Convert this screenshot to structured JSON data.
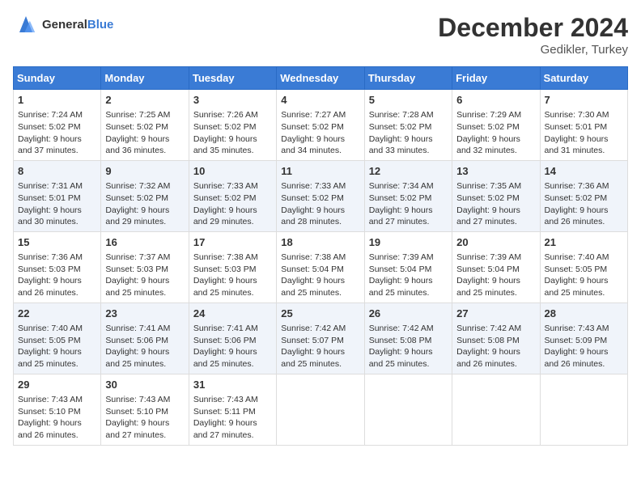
{
  "logo": {
    "text_general": "General",
    "text_blue": "Blue"
  },
  "title": "December 2024",
  "location": "Gedikler, Turkey",
  "days_header": [
    "Sunday",
    "Monday",
    "Tuesday",
    "Wednesday",
    "Thursday",
    "Friday",
    "Saturday"
  ],
  "weeks": [
    [
      {
        "day": "1",
        "sunrise": "7:24 AM",
        "sunset": "5:02 PM",
        "daylight": "9 hours and 37 minutes."
      },
      {
        "day": "2",
        "sunrise": "7:25 AM",
        "sunset": "5:02 PM",
        "daylight": "9 hours and 36 minutes."
      },
      {
        "day": "3",
        "sunrise": "7:26 AM",
        "sunset": "5:02 PM",
        "daylight": "9 hours and 35 minutes."
      },
      {
        "day": "4",
        "sunrise": "7:27 AM",
        "sunset": "5:02 PM",
        "daylight": "9 hours and 34 minutes."
      },
      {
        "day": "5",
        "sunrise": "7:28 AM",
        "sunset": "5:02 PM",
        "daylight": "9 hours and 33 minutes."
      },
      {
        "day": "6",
        "sunrise": "7:29 AM",
        "sunset": "5:02 PM",
        "daylight": "9 hours and 32 minutes."
      },
      {
        "day": "7",
        "sunrise": "7:30 AM",
        "sunset": "5:01 PM",
        "daylight": "9 hours and 31 minutes."
      }
    ],
    [
      {
        "day": "8",
        "sunrise": "7:31 AM",
        "sunset": "5:01 PM",
        "daylight": "9 hours and 30 minutes."
      },
      {
        "day": "9",
        "sunrise": "7:32 AM",
        "sunset": "5:02 PM",
        "daylight": "9 hours and 29 minutes."
      },
      {
        "day": "10",
        "sunrise": "7:33 AM",
        "sunset": "5:02 PM",
        "daylight": "9 hours and 29 minutes."
      },
      {
        "day": "11",
        "sunrise": "7:33 AM",
        "sunset": "5:02 PM",
        "daylight": "9 hours and 28 minutes."
      },
      {
        "day": "12",
        "sunrise": "7:34 AM",
        "sunset": "5:02 PM",
        "daylight": "9 hours and 27 minutes."
      },
      {
        "day": "13",
        "sunrise": "7:35 AM",
        "sunset": "5:02 PM",
        "daylight": "9 hours and 27 minutes."
      },
      {
        "day": "14",
        "sunrise": "7:36 AM",
        "sunset": "5:02 PM",
        "daylight": "9 hours and 26 minutes."
      }
    ],
    [
      {
        "day": "15",
        "sunrise": "7:36 AM",
        "sunset": "5:03 PM",
        "daylight": "9 hours and 26 minutes."
      },
      {
        "day": "16",
        "sunrise": "7:37 AM",
        "sunset": "5:03 PM",
        "daylight": "9 hours and 25 minutes."
      },
      {
        "day": "17",
        "sunrise": "7:38 AM",
        "sunset": "5:03 PM",
        "daylight": "9 hours and 25 minutes."
      },
      {
        "day": "18",
        "sunrise": "7:38 AM",
        "sunset": "5:04 PM",
        "daylight": "9 hours and 25 minutes."
      },
      {
        "day": "19",
        "sunrise": "7:39 AM",
        "sunset": "5:04 PM",
        "daylight": "9 hours and 25 minutes."
      },
      {
        "day": "20",
        "sunrise": "7:39 AM",
        "sunset": "5:04 PM",
        "daylight": "9 hours and 25 minutes."
      },
      {
        "day": "21",
        "sunrise": "7:40 AM",
        "sunset": "5:05 PM",
        "daylight": "9 hours and 25 minutes."
      }
    ],
    [
      {
        "day": "22",
        "sunrise": "7:40 AM",
        "sunset": "5:05 PM",
        "daylight": "9 hours and 25 minutes."
      },
      {
        "day": "23",
        "sunrise": "7:41 AM",
        "sunset": "5:06 PM",
        "daylight": "9 hours and 25 minutes."
      },
      {
        "day": "24",
        "sunrise": "7:41 AM",
        "sunset": "5:06 PM",
        "daylight": "9 hours and 25 minutes."
      },
      {
        "day": "25",
        "sunrise": "7:42 AM",
        "sunset": "5:07 PM",
        "daylight": "9 hours and 25 minutes."
      },
      {
        "day": "26",
        "sunrise": "7:42 AM",
        "sunset": "5:08 PM",
        "daylight": "9 hours and 25 minutes."
      },
      {
        "day": "27",
        "sunrise": "7:42 AM",
        "sunset": "5:08 PM",
        "daylight": "9 hours and 26 minutes."
      },
      {
        "day": "28",
        "sunrise": "7:43 AM",
        "sunset": "5:09 PM",
        "daylight": "9 hours and 26 minutes."
      }
    ],
    [
      {
        "day": "29",
        "sunrise": "7:43 AM",
        "sunset": "5:10 PM",
        "daylight": "9 hours and 26 minutes."
      },
      {
        "day": "30",
        "sunrise": "7:43 AM",
        "sunset": "5:10 PM",
        "daylight": "9 hours and 27 minutes."
      },
      {
        "day": "31",
        "sunrise": "7:43 AM",
        "sunset": "5:11 PM",
        "daylight": "9 hours and 27 minutes."
      },
      null,
      null,
      null,
      null
    ]
  ],
  "labels": {
    "sunrise": "Sunrise:",
    "sunset": "Sunset:",
    "daylight": "Daylight:"
  }
}
